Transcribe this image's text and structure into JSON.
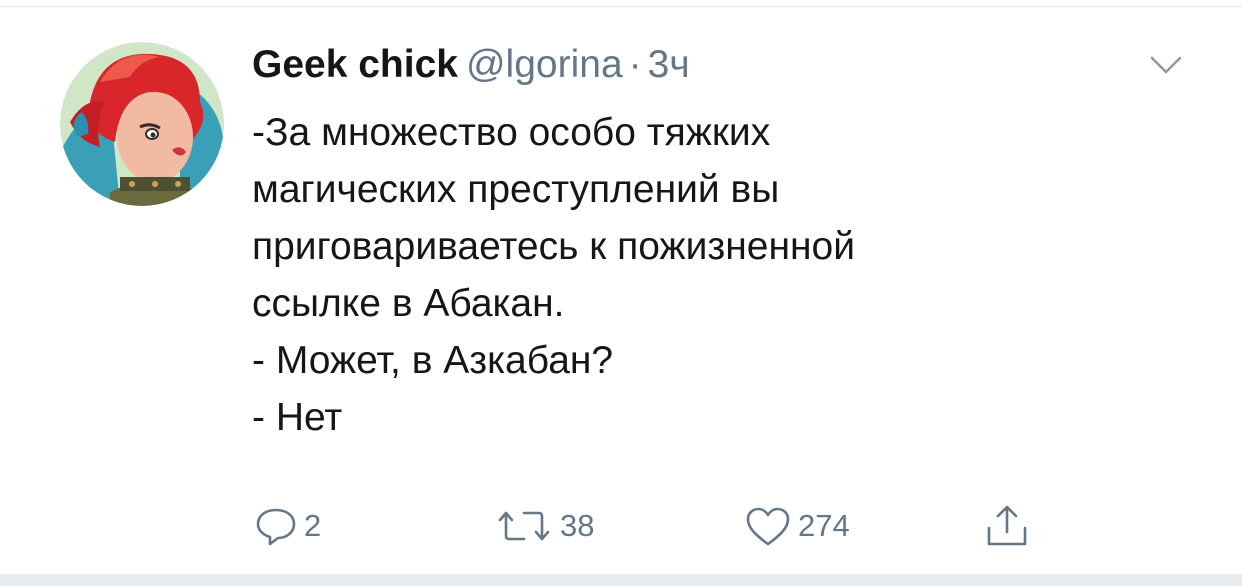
{
  "tweet": {
    "author_name": "Geek chick",
    "handle": "@lgorina",
    "separator": "·",
    "timestamp": "3ч",
    "body_lines": [
      "-За множество особо тяжких",
      "магических преступлений вы",
      "приговариваетесь к пожизненной",
      "ссылке в Абакан.",
      "- Может, в Азкабан?",
      "- Нет"
    ]
  },
  "actions": {
    "reply_count": "2",
    "retweet_count": "38",
    "like_count": "274"
  },
  "icons": {
    "avatar": "avatar-illustration",
    "menu": "chevron-down-icon",
    "reply": "reply-icon",
    "retweet": "retweet-icon",
    "like": "heart-icon",
    "share": "share-icon"
  },
  "colors": {
    "text": "#14171a",
    "secondary_text": "#657786",
    "divider": "#e6ecf0"
  }
}
